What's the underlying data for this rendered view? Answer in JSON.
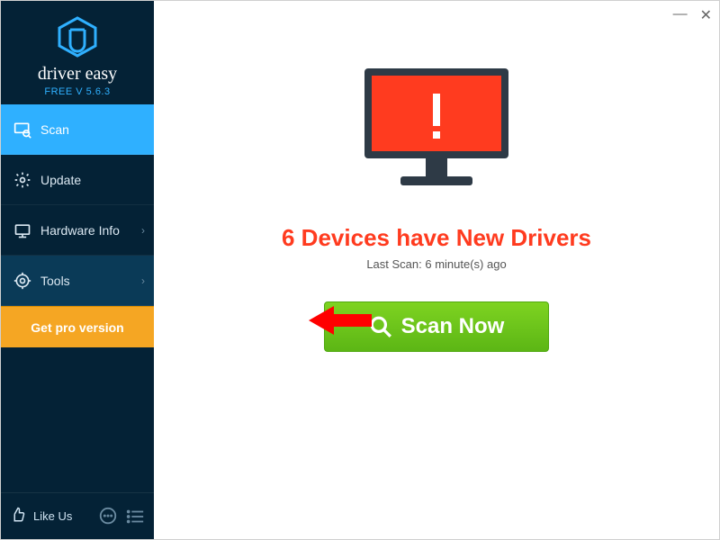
{
  "brand": {
    "name": "driver easy",
    "version": "FREE V 5.6.3"
  },
  "sidebar": {
    "items": [
      {
        "label": "Scan"
      },
      {
        "label": "Update"
      },
      {
        "label": "Hardware Info"
      },
      {
        "label": "Tools"
      }
    ],
    "pro_label": "Get pro version",
    "like_label": "Like Us"
  },
  "main": {
    "headline": "6 Devices have New Drivers",
    "last_scan": "Last Scan: 6 minute(s) ago",
    "scan_button": "Scan Now"
  },
  "colors": {
    "accent": "#2fb0ff",
    "alert": "#ff3b1f",
    "action": "#7ed321",
    "pro": "#f5a623"
  }
}
